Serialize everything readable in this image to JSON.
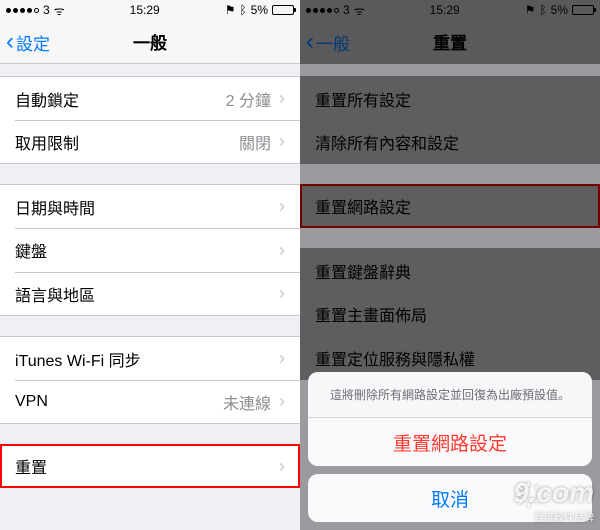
{
  "status": {
    "carrier": "3",
    "time": "15:29",
    "battery_pct": "5%"
  },
  "left": {
    "back_label": "設定",
    "title": "一般",
    "rows": {
      "auto_lock": {
        "label": "自動鎖定",
        "value": "2 分鐘"
      },
      "restrictions": {
        "label": "取用限制",
        "value": "關閉"
      },
      "date_time": {
        "label": "日期與時間"
      },
      "keyboard": {
        "label": "鍵盤"
      },
      "lang_region": {
        "label": "語言與地區"
      },
      "itunes_wifi": {
        "label": "iTunes Wi-Fi 同步"
      },
      "vpn": {
        "label": "VPN",
        "value": "未連線"
      },
      "reset": {
        "label": "重置"
      }
    }
  },
  "right": {
    "back_label": "一般",
    "title": "重置",
    "rows": {
      "reset_all": {
        "label": "重置所有設定"
      },
      "erase_all": {
        "label": "清除所有內容和設定"
      },
      "reset_network": {
        "label": "重置網路設定"
      },
      "reset_keyboard": {
        "label": "重置鍵盤辭典"
      },
      "reset_home": {
        "label": "重置主畫面佈局"
      },
      "reset_location": {
        "label": "重置定位服務與隱私權"
      }
    },
    "sheet": {
      "message": "這將刪除所有網路設定並回復為出廠預設值。",
      "confirm": "重置網路設定",
      "cancel": "取消"
    }
  },
  "watermark": {
    "main": "9҉.com",
    "sub": "百度軟件品牌"
  }
}
